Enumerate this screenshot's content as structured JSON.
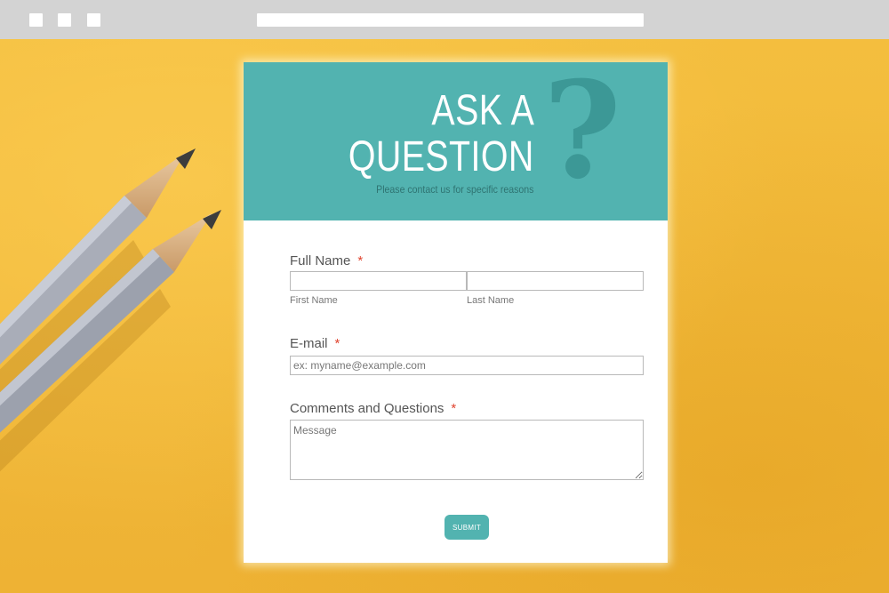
{
  "hero": {
    "title_line1": "ASK A",
    "title_line2": "QUESTION",
    "subtitle": "Please contact us for specific reasons",
    "decoration": "?"
  },
  "form": {
    "full_name": {
      "label": "Full Name",
      "required_mark": "*",
      "first_value": "",
      "last_value": "",
      "first_sublabel": "First Name",
      "last_sublabel": "Last Name"
    },
    "email": {
      "label": "E-mail",
      "required_mark": "*",
      "value": "",
      "placeholder": "ex: myname@example.com"
    },
    "comments": {
      "label": "Comments and Questions",
      "required_mark": "*",
      "value": "",
      "placeholder": "Message"
    },
    "submit_label": "SUBMIT"
  },
  "colors": {
    "accent": "#52b3b0",
    "background": "#f0b93a",
    "required": "#e0442f",
    "chrome": "#d3d3d3"
  }
}
